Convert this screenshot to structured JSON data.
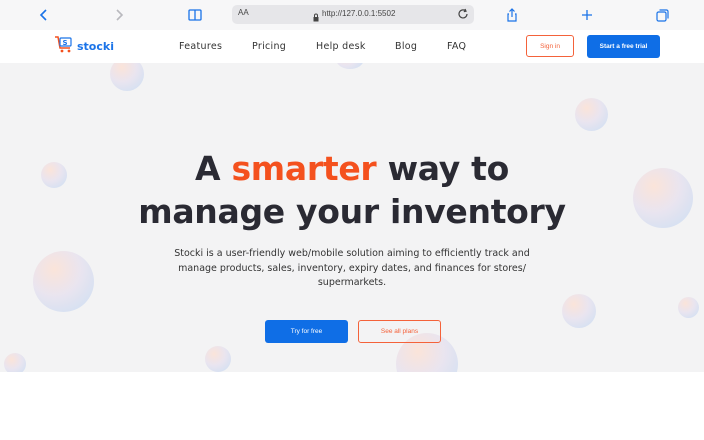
{
  "browser": {
    "url_prefix": "AA",
    "url": "http://127.0.0.1:5502",
    "icons": [
      "back-icon",
      "forward-icon",
      "book-icon",
      "lock-icon",
      "reload-icon",
      "share-icon",
      "new-tab-icon",
      "tabs-icon"
    ]
  },
  "nav": {
    "logo_text": "stocki",
    "logo_mark": "S",
    "links": [
      "Features",
      "Pricing",
      "Help desk",
      "Blog",
      "FAQ"
    ],
    "signin_label": "Sign in",
    "trial_label": "Start a free trial"
  },
  "hero": {
    "title_pre": "A ",
    "title_accent": "smarter",
    "title_post": " way to",
    "title_line2": "manage your inventory",
    "description": "Stocki is a user-friendly web/mobile solution aiming to efficiently track and manage products, sales, inventory, expiry dates, and finances for stores/ supermarkets.",
    "try_label": "Try for free",
    "plans_label": "See all plans"
  },
  "colors": {
    "brand_blue": "#0f6ee6",
    "accent_orange": "#f4511e",
    "hero_bg": "#f3f3f4"
  }
}
